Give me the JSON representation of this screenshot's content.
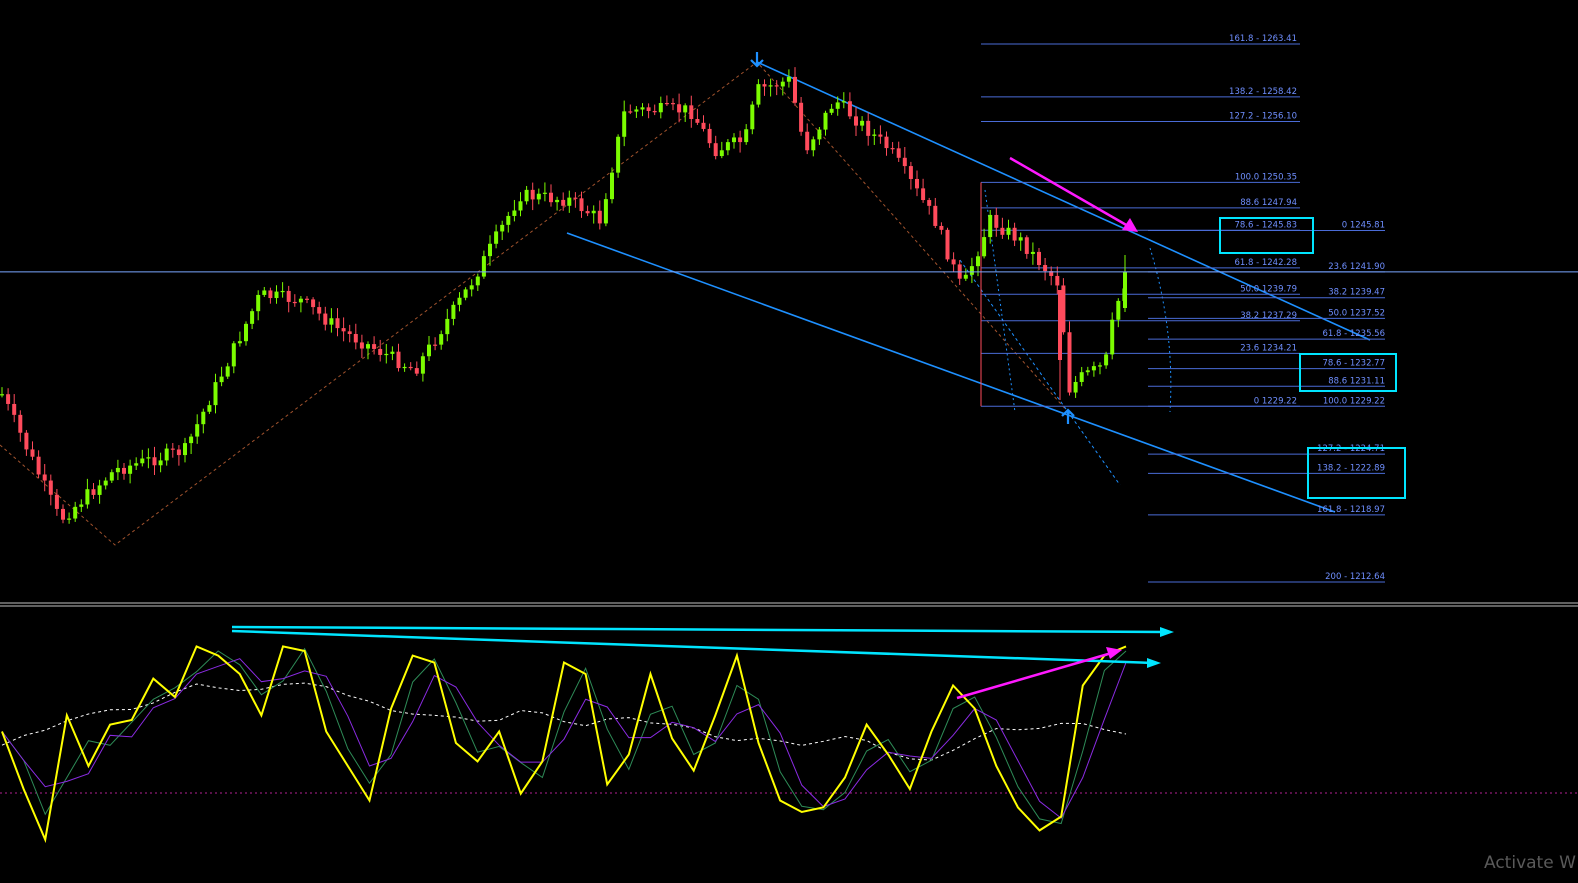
{
  "watermark": "Activate W",
  "colors": {
    "background": "#000000",
    "bull": "#7CFC00",
    "bear": "#FF4B5C",
    "fib": "#4a6bd6",
    "fib_label": "#6f8fff",
    "channel": "#1e90ff",
    "highlight": "#00e5ff",
    "magenta": "#ff19ff",
    "stoch_main": "#ffff00",
    "stoch_signal_1": "#2e8b57",
    "stoch_signal_2": "#8a2be2",
    "zigzag": "#a0522d",
    "price_line": "#7aa7ff",
    "stoch_dashed": "#ffffff",
    "stoch_level": "#b0208f"
  },
  "chart_data": [
    {
      "type": "candlestick",
      "y_min": 1212.64,
      "y_max": 1263.41,
      "current_price_line": 1241.9,
      "fib_retracement_1": [
        {
          "level": "161.8",
          "price": "1263.41",
          "text": "161.8 - 1263.41"
        },
        {
          "level": "138.2",
          "price": "1258.42",
          "text": "138.2 - 1258.42"
        },
        {
          "level": "127.2",
          "price": "1256.10",
          "text": "127.2 - 1256.10"
        },
        {
          "level": "100.0",
          "price": "1250.35",
          "text": "100.0 1250.35"
        },
        {
          "level": "88.6",
          "price": "1247.94",
          "text": "88.6 1247.94"
        },
        {
          "level": "78.6",
          "price": "1245.83",
          "text": "78.6 - 1245.83"
        },
        {
          "level": "61.8",
          "price": "1242.28",
          "text": "61.8 - 1242.28"
        },
        {
          "level": "50.0",
          "price": "1239.79",
          "text": "50.0 1239.79"
        },
        {
          "level": "38.2",
          "price": "1237.29",
          "text": "38.2 1237.29"
        },
        {
          "level": "23.6",
          "price": "1234.21",
          "text": "23.6 1234.21"
        },
        {
          "level": "0",
          "price": "1229.22",
          "text": "0 1229.22"
        }
      ],
      "fib_retracement_2": [
        {
          "level": "0",
          "price": "1245.81",
          "text": "0 1245.81"
        },
        {
          "level": "23.6",
          "price": "1241.90",
          "text": "23.6 1241.90"
        },
        {
          "level": "38.2",
          "price": "1239.47",
          "text": "38.2 1239.47"
        },
        {
          "level": "50.0",
          "price": "1237.52",
          "text": "50.0 1237.52"
        },
        {
          "level": "61.8",
          "price": "1235.56",
          "text": "61.8 - 1235.56"
        },
        {
          "level": "78.6",
          "price": "1232.77",
          "text": "78.6 - 1232.77"
        },
        {
          "level": "88.6",
          "price": "1231.11",
          "text": "88.6 1231.11"
        },
        {
          "level": "100.0",
          "price": "1229.22",
          "text": "100.0 1229.22"
        },
        {
          "level": "127.2",
          "price": "1224.71",
          "text": "127.2 - 1224.71"
        },
        {
          "level": "138.2",
          "price": "1222.89",
          "text": "138.2 - 1222.89"
        },
        {
          "level": "161.8",
          "price": "1218.97",
          "text": "161.8 - 1218.97"
        },
        {
          "level": "200",
          "price": "1212.64",
          "text": "200 - 1212.64"
        }
      ],
      "highlighted_levels": [
        "78.6 - 1245.83",
        "78.6 - 1232.77 / 88.6 - 1231.11",
        "127.2 - 1224.71 / 138.2 - 1222.89"
      ]
    },
    {
      "type": "line",
      "series": [
        {
          "values": [
            55,
            30,
            8,
            62,
            40,
            58,
            60,
            78,
            70,
            92,
            88,
            80,
            62,
            92,
            90,
            55,
            40,
            25,
            65,
            88,
            85,
            50,
            42,
            55,
            28,
            42,
            85,
            80,
            32,
            45,
            80,
            52,
            38,
            62,
            88,
            50,
            25,
            20,
            22,
            35,
            58,
            45,
            30,
            55,
            75,
            65,
            40,
            22,
            12,
            18,
            75,
            88,
            92
          ]
        }
      ]
    }
  ]
}
